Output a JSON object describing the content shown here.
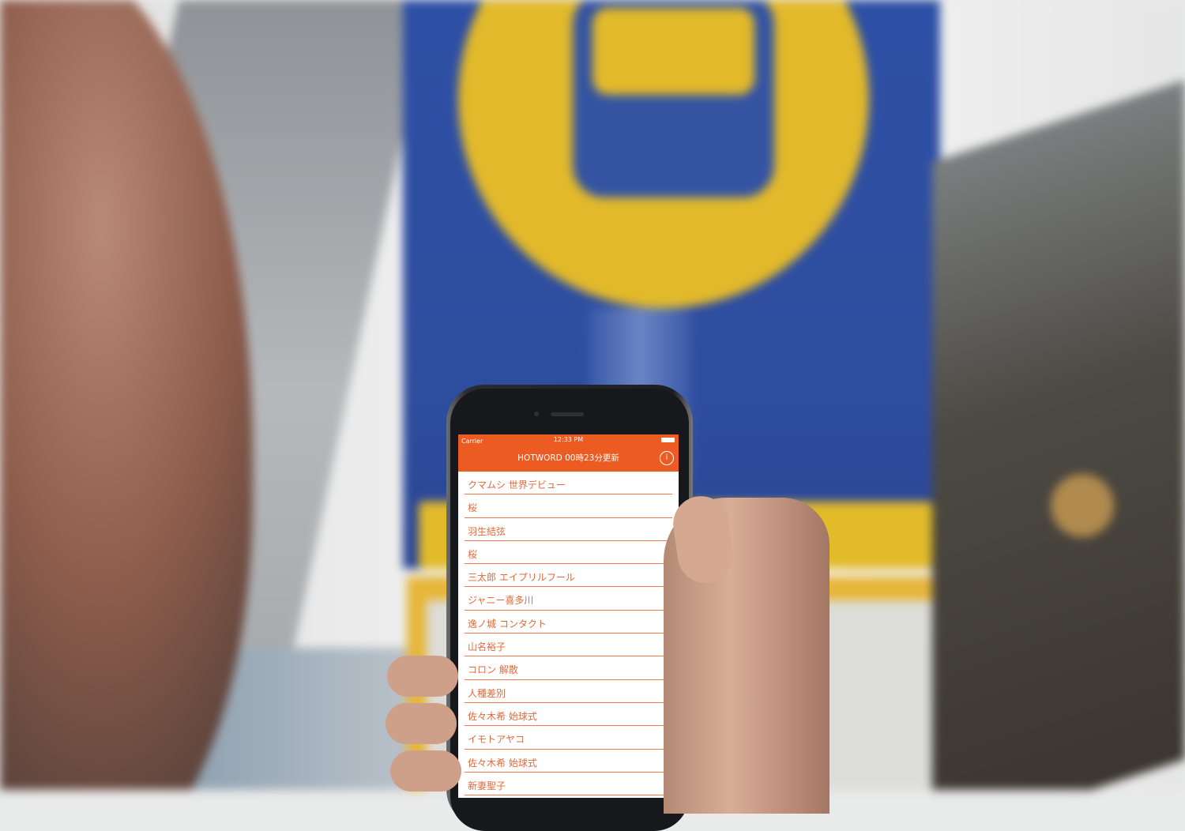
{
  "status_bar": {
    "carrier": "Carrier",
    "time": "12:33 PM"
  },
  "nav": {
    "title": "HOTWORD 00時23分更新",
    "info_icon": "info-icon"
  },
  "hotwords": [
    "クマムシ 世界デビュー",
    "桜",
    "羽生結弦",
    "桜",
    "三太郎 エイプリルフール",
    "ジャニー喜多川",
    "逸ノ城 コンタクト",
    "山名裕子",
    "コロン 解散",
    "人種差別",
    "佐々木希 始球式",
    "イモトアヤコ",
    "佐々木希 始球式",
    "新妻聖子"
  ],
  "colors": {
    "accent": "#ec5b22",
    "text": "#e06a3a"
  }
}
